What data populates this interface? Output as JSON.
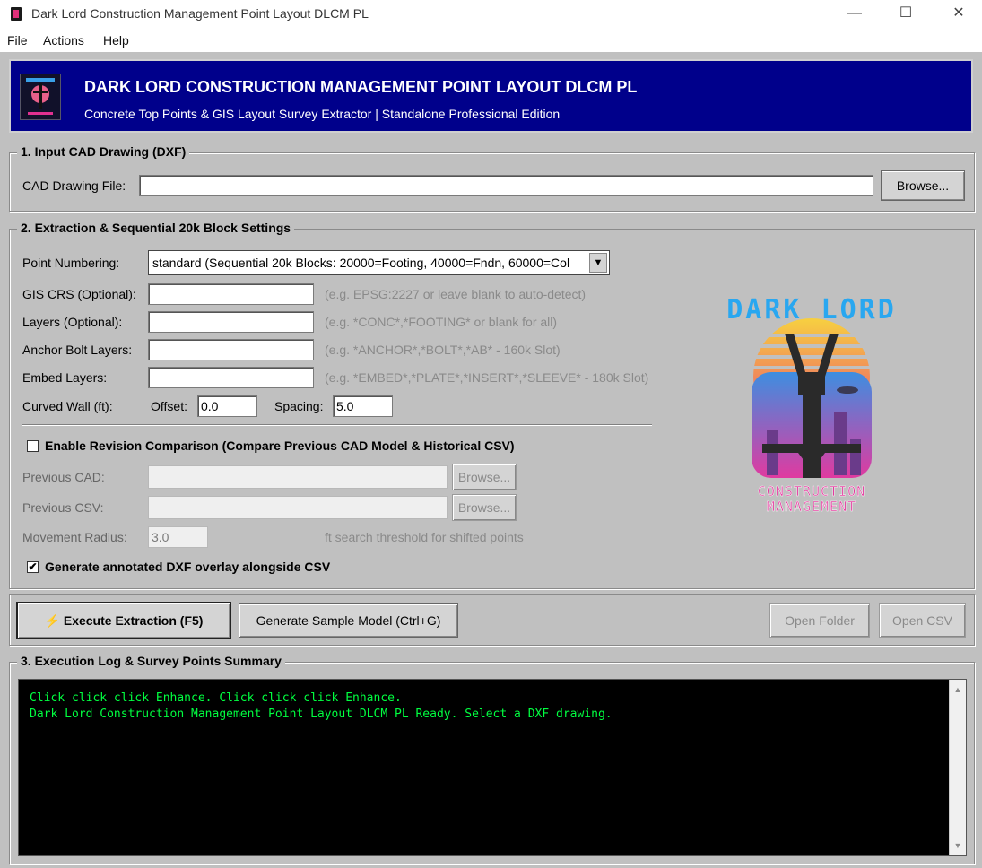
{
  "window": {
    "title": "Dark Lord Construction Management Point Layout DLCM PL",
    "minimize_glyph": "—",
    "maximize_glyph": "☐",
    "close_glyph": "✕"
  },
  "menu": [
    "File",
    "Actions",
    "Help"
  ],
  "banner": {
    "title": "DARK LORD CONSTRUCTION MANAGEMENT POINT LAYOUT DLCM PL",
    "subtitle": "Concrete Top Points & GIS Layout Survey Extractor | Standalone Professional Edition",
    "background_color": "#00008b"
  },
  "section1": {
    "legend": "1. Input CAD Drawing (DXF)",
    "file_label": "CAD Drawing File:",
    "file_value": "",
    "browse_label": "Browse..."
  },
  "section2": {
    "legend": "2. Extraction & Sequential 20k Block Settings",
    "numbering_label": "Point Numbering:",
    "numbering_value": "standard (Sequential 20k Blocks: 20000=Footing, 40000=Fndn, 60000=Col",
    "gis_label": "GIS CRS (Optional):",
    "gis_value": "",
    "gis_hint": "(e.g. EPSG:2227 or leave blank to auto-detect)",
    "layers_label": "Layers (Optional):",
    "layers_value": "",
    "layers_hint": "(e.g. *CONC*,*FOOTING* or blank for all)",
    "anchor_label": "Anchor Bolt Layers:",
    "anchor_value": "",
    "anchor_hint": "(e.g. *ANCHOR*,*BOLT*,*AB* - 160k Slot)",
    "embed_label": "Embed Layers:",
    "embed_value": "",
    "embed_hint": "(e.g. *EMBED*,*PLATE*,*INSERT*,*SLEEVE* - 180k Slot)",
    "curved_label": "Curved Wall (ft):",
    "offset_label": "Offset:",
    "offset_value": "0.0",
    "spacing_label": "Spacing:",
    "spacing_value": "5.0",
    "revision_checked": false,
    "revision_label": "Enable Revision Comparison (Compare Previous CAD Model & Historical CSV)",
    "prev_cad_label": "Previous CAD:",
    "prev_cad_value": "",
    "prev_csv_label": "Previous CSV:",
    "prev_csv_value": "",
    "browse_label": "Browse...",
    "radius_label": "Movement Radius:",
    "radius_value": "3.0",
    "radius_hint": "ft search threshold for shifted points",
    "overlay_checked": true,
    "overlay_label": "Generate annotated DXF overlay alongside CSV",
    "checkmark_glyph": "✔",
    "logo": {
      "line1": "DARK LORD",
      "line2": "CONSTRUCTION",
      "line3": "MANAGEMENT"
    }
  },
  "actions": {
    "execute_icon": "⚡",
    "execute_label": "Execute Extraction (F5)",
    "sample_label": "Generate Sample Model (Ctrl+G)",
    "open_folder_label": "Open Folder",
    "open_csv_label": "Open CSV"
  },
  "section3": {
    "legend": "3. Execution Log & Survey Points Summary",
    "lines": [
      "Click click click Enhance. Click click click Enhance.",
      "Dark Lord Construction Management Point Layout DLCM PL Ready. Select a DXF drawing."
    ],
    "scroll_up_glyph": "▲",
    "scroll_down_glyph": "▼"
  }
}
